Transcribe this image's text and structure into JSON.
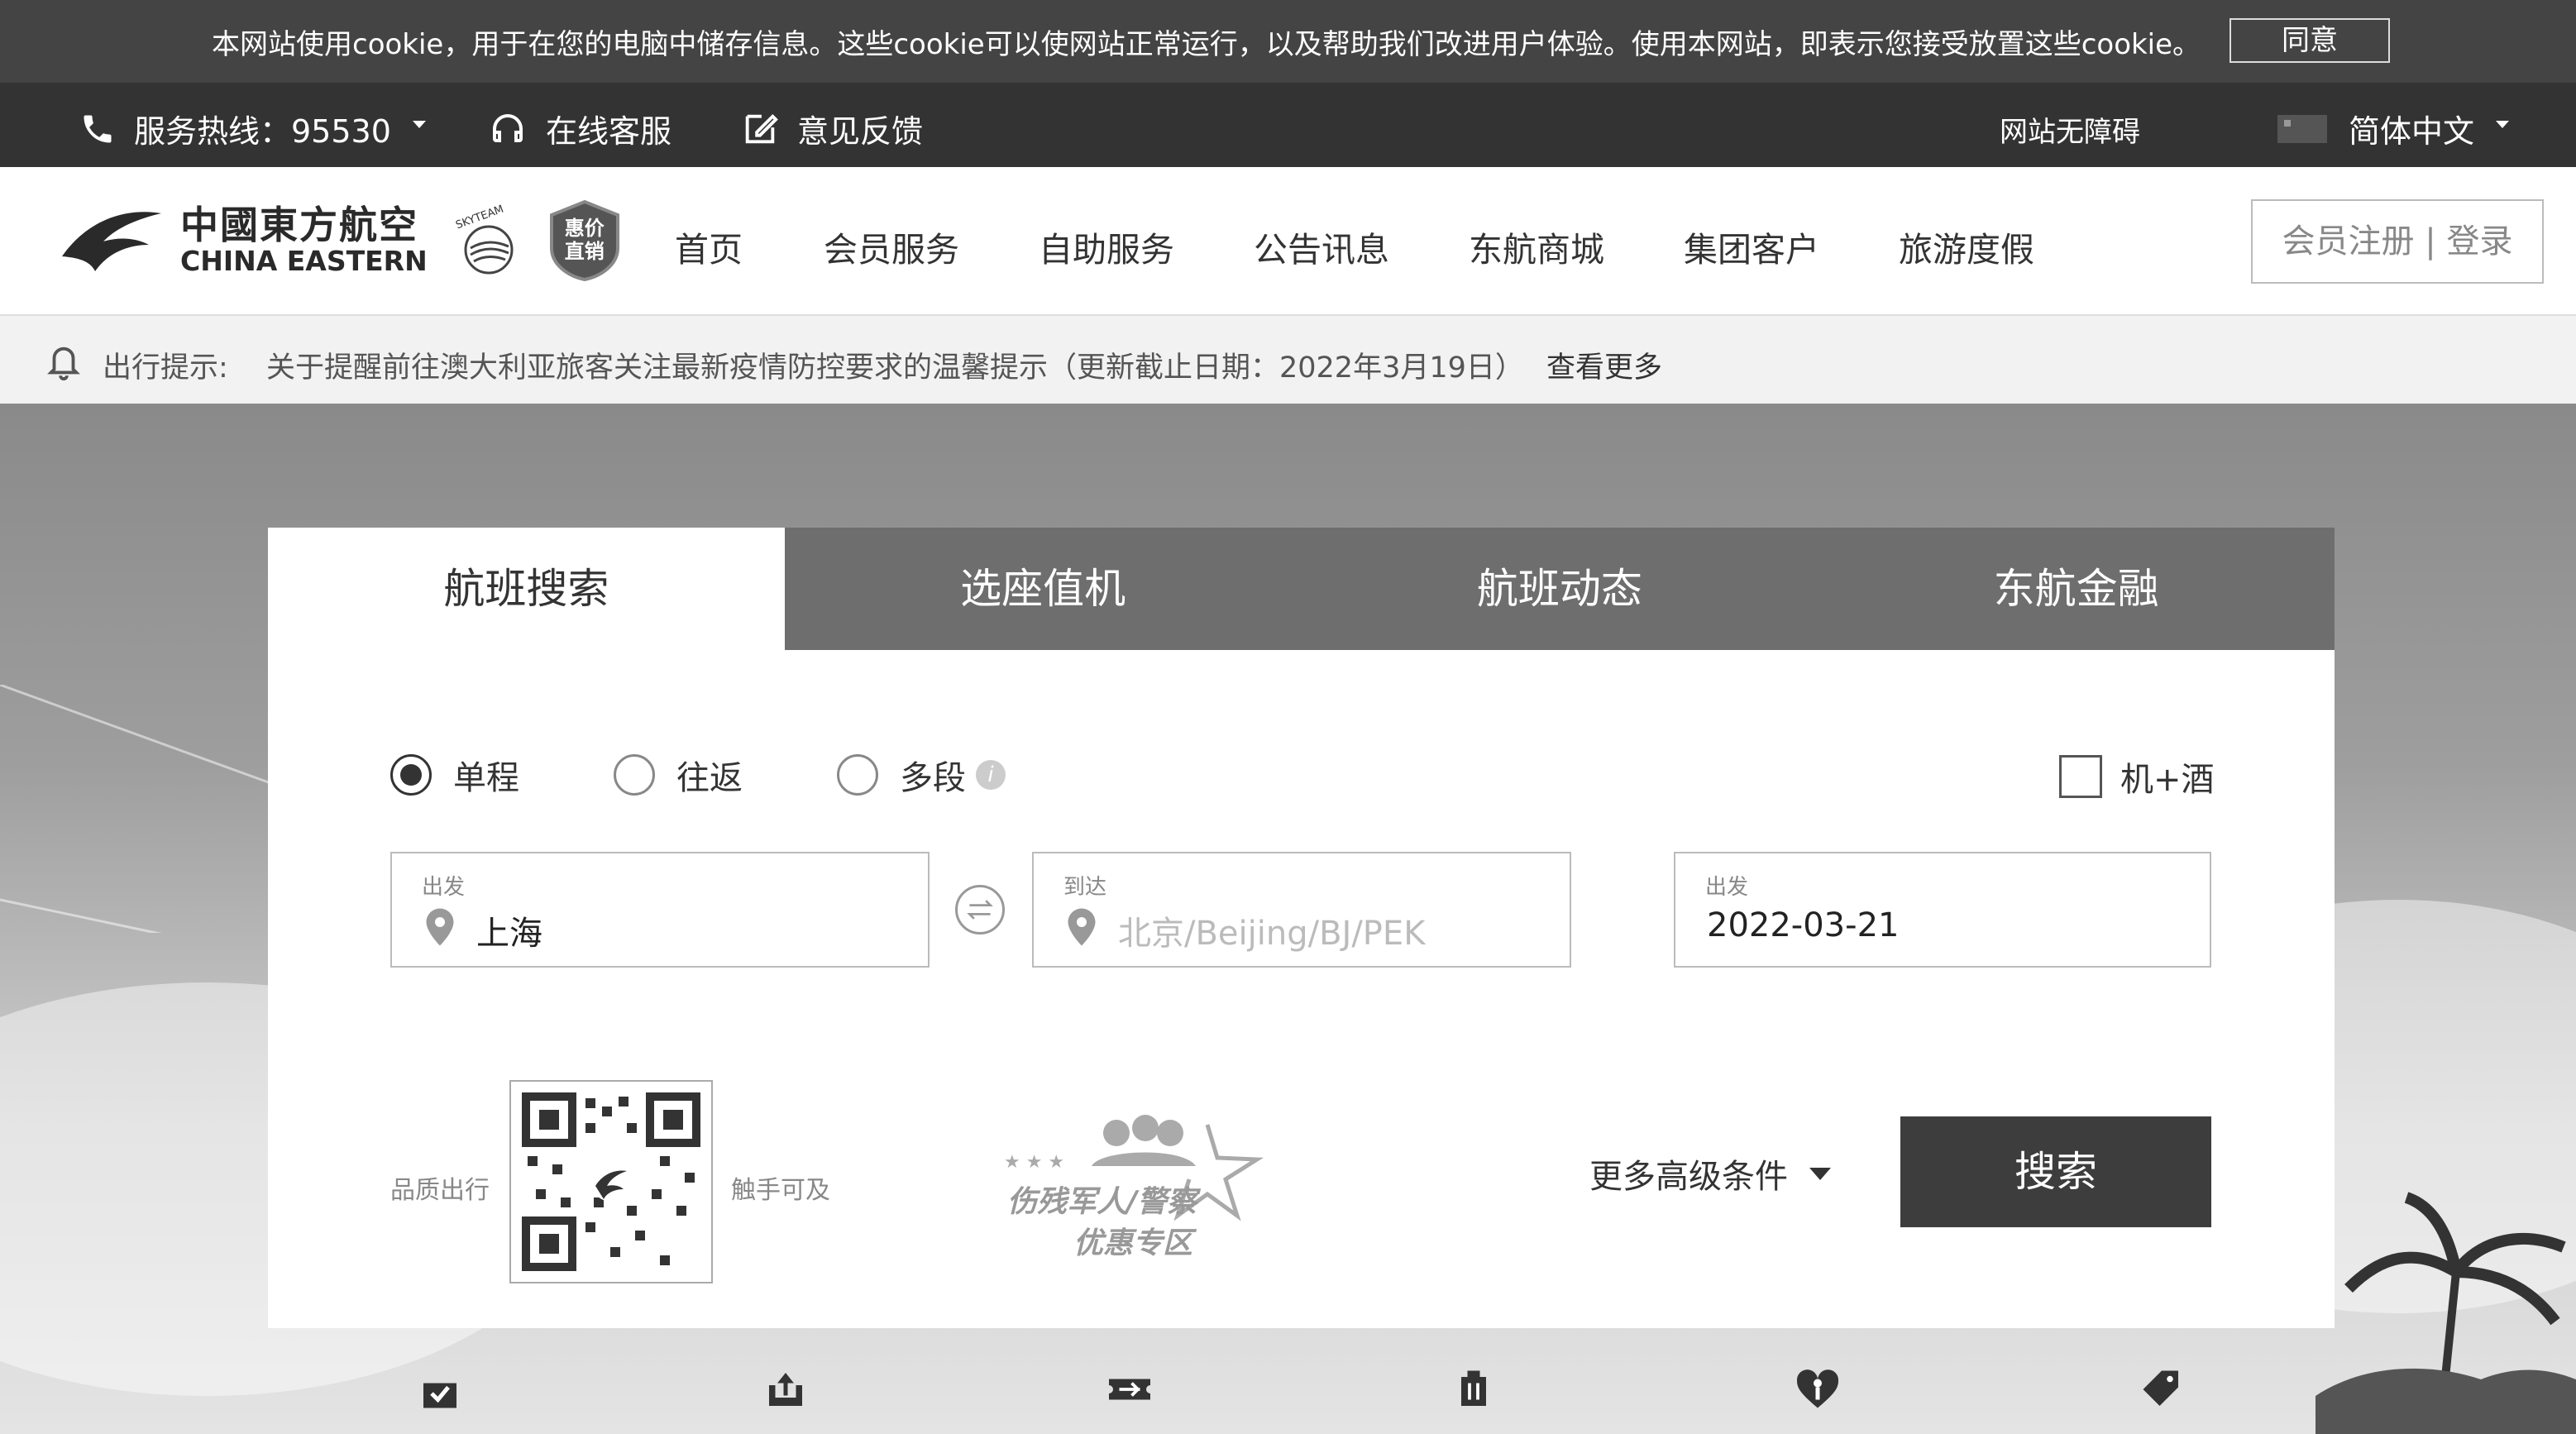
{
  "cookie_bar": {
    "message": "本网站使用cookie，用于在您的电脑中储存信息。这些cookie可以使网站正常运行，以及帮助我们改进用户体验。使用本网站，即表示您接受放置这些cookie。",
    "agree_label": "同意"
  },
  "top_bar": {
    "hotline": "服务热线：95530",
    "online_service": "在线客服",
    "feedback": "意见反馈",
    "accessibility": "网站无障碍",
    "language": "简体中文"
  },
  "header": {
    "logo_cn": "中國東方航空",
    "logo_en": "CHINA EASTERN",
    "skyteam": "SKYTEAM",
    "badge": "惠价直销",
    "nav": [
      "首页",
      "会员服务",
      "自助服务",
      "公告讯息",
      "东航商城",
      "集团客户",
      "旅游度假"
    ],
    "login": "会员注册 | 登录"
  },
  "notice": {
    "label": "出行提示:",
    "text": "关于提醒前往澳大利亚旅客关注最新疫情防控要求的温馨提示（更新截止日期：2022年3月19日）",
    "more": "查看更多"
  },
  "search_panel": {
    "tabs": [
      "航班搜索",
      "选座值机",
      "航班动态",
      "东航金融"
    ],
    "trip_types": [
      "单程",
      "往返",
      "多段"
    ],
    "selected_trip_type": "单程",
    "flight_hotel": "机+酒",
    "from": {
      "label": "出发",
      "value": "上海"
    },
    "to": {
      "label": "到达",
      "placeholder": "北京/Beijing/BJ/PEK"
    },
    "date": {
      "label": "出发",
      "value": "2022-03-21"
    },
    "qr_left": "品质出行",
    "qr_right": "触手可及",
    "promo_line1": "伤残军人/警察",
    "promo_line2": "优惠专区",
    "advanced": "更多高级条件",
    "search_button": "搜索"
  },
  "quick_icons": [
    "calendar-check-icon",
    "upload-seat-icon",
    "ticket-plane-icon",
    "luggage-icon",
    "heart-care-icon",
    "tag-icon"
  ]
}
